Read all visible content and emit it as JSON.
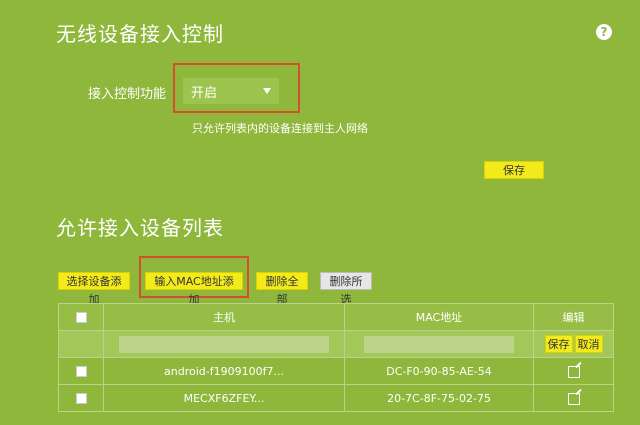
{
  "header": {
    "title": "无线设备接入控制",
    "help_icon": "?"
  },
  "access_control": {
    "label": "接入控制功能",
    "selected": "开启",
    "hint": "只允许列表内的设备连接到主人网络",
    "save_label": "保存"
  },
  "list_section": {
    "title": "允许接入设备列表",
    "buttons": {
      "select_add": "选择设备添加",
      "mac_add": "输入MAC地址添加",
      "delete_all": "删除全部",
      "delete_selected": "删除所选"
    },
    "columns": {
      "host": "主机",
      "mac": "MAC地址",
      "edit": "编辑"
    },
    "row_buttons": {
      "save": "保存",
      "cancel": "取消"
    },
    "rows": [
      {
        "host": "android-f1909100f7...",
        "mac": "DC-F0-90-85-AE-54"
      },
      {
        "host": "MECXF6ZFEY...",
        "mac": "20-7C-8F-75-02-75"
      }
    ]
  },
  "colors": {
    "background": "#8fb73c",
    "button_yellow": "#f2ea1a",
    "highlight_red": "#d4502c"
  }
}
